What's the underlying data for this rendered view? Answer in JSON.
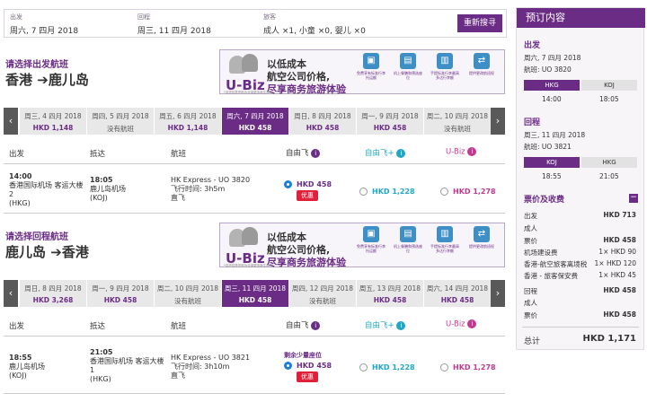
{
  "header": {
    "out_label": "出发",
    "out_value": "周六, 7 四月 2018",
    "ret_label": "回程",
    "ret_value": "周三, 11 四月 2018",
    "pax_label": "旅客",
    "pax_value": "成人 ×1, 小童 ×0, 婴儿 ×0",
    "search_button": "重新搜寻"
  },
  "banner": {
    "brand": "U-Biz",
    "line1": "以低成本",
    "line2": "航空公司价格,",
    "line3": "尽享商务旅游体验",
    "fine_print": "*该货包售完即为全部更多新生商务",
    "features": [
      "免费享有标准行李托运额",
      "机上餐膳和预选座位",
      "手提标准行李最高多达行李额",
      "提供更改航班权"
    ]
  },
  "outbound": {
    "title": "请选择出发航班",
    "from": "香港",
    "to": "鹿儿岛",
    "dates": [
      {
        "d": "周三, 4 四月 2018",
        "p": "HKD 1,148"
      },
      {
        "d": "周四, 5 四月 2018",
        "p": "没有航班"
      },
      {
        "d": "周五, 6 四月 2018",
        "p": "HKD 1,148"
      },
      {
        "d": "周六, 7 四月 2018",
        "p": "HKD 458"
      },
      {
        "d": "周日, 8 四月 2018",
        "p": "HKD 458"
      },
      {
        "d": "周一, 9 四月 2018",
        "p": "HKD 458"
      },
      {
        "d": "周二, 10 四月 2018",
        "p": "没有航班"
      }
    ],
    "cols": {
      "depart": "出发",
      "arrive": "抵达",
      "flight": "航班",
      "fare1": "自由飞",
      "fare2": "自由飞+",
      "fare3": "U-Biz"
    },
    "flight": {
      "dep_time": "14:00",
      "dep_place": "香港国际机场 客运大楼 2",
      "dep_code": "(HKG)",
      "arr_time": "18:05",
      "arr_place": "鹿儿岛机场",
      "arr_code": "(KOJ)",
      "no": "HK Express - UO 3820",
      "dur": "飞行时间: 3h5m",
      "type": "直飞",
      "p1": "HKD 458",
      "p2": "HKD 1,228",
      "p3": "HKD 1,278",
      "badge": "优惠"
    }
  },
  "inbound": {
    "title": "请选择回程航班",
    "from": "鹿儿岛",
    "to": "香港",
    "dates": [
      {
        "d": "周日, 8 四月 2018",
        "p": "HKD 3,268"
      },
      {
        "d": "周一, 9 四月 2018",
        "p": "HKD 458"
      },
      {
        "d": "周二, 10 四月 2018",
        "p": "没有航班"
      },
      {
        "d": "周三, 11 四月 2018",
        "p": "HKD 458"
      },
      {
        "d": "周四, 12 四月 2018",
        "p": "没有航班"
      },
      {
        "d": "周五, 13 四月 2018",
        "p": "HKD 458"
      },
      {
        "d": "周六, 14 四月 2018",
        "p": "HKD 458"
      }
    ],
    "cols": {
      "depart": "出发",
      "arrive": "抵达",
      "flight": "航班",
      "fare1": "自由飞",
      "fare2": "自由飞+",
      "fare3": "U-Biz"
    },
    "flight": {
      "dep_time": "18:55",
      "dep_place": "鹿儿岛机场",
      "dep_code": "(KOJ)",
      "arr_time": "21:05",
      "arr_place": "香港国际机场 客运大楼 1",
      "arr_code": "(HKG)",
      "no": "HK Express - UO 3821",
      "dur": "飞行时间: 3h10m",
      "type": "直飞",
      "seats_left": "剩余少量座位",
      "p1": "HKD 458",
      "p2": "HKD 1,228",
      "p3": "HKD 1,278",
      "badge": "优惠"
    }
  },
  "summary": {
    "title": "预订内容",
    "out_h": "出发",
    "out_date": "周六, 7 四月 2018",
    "out_flight": "航班: UO 3820",
    "out_from": "HKG",
    "out_to": "KOJ",
    "out_t1": "14:00",
    "out_t2": "18:05",
    "ret_h": "回程",
    "ret_date": "周三, 11 四月 2018",
    "ret_flight": "航班: UO 3821",
    "ret_from": "KOJ",
    "ret_to": "HKG",
    "ret_t1": "18:55",
    "ret_t2": "21:05",
    "fees_h": "票价及收费",
    "minus": "−",
    "rows": [
      [
        "出发",
        "HKD 713"
      ],
      [
        "成人",
        ""
      ],
      [
        "票价",
        "HKD 458"
      ],
      [
        "机场建设费",
        "1× HKD 90"
      ],
      [
        "香港-航空旅客离境税",
        "1× HKD 120"
      ],
      [
        "香港 - 旅客保安费",
        "1× HKD 45"
      ],
      [
        "回程",
        "HKD 458"
      ],
      [
        "成人",
        ""
      ],
      [
        "票价",
        "HKD 458"
      ]
    ],
    "total_label": "总计",
    "total_value": "HKD 1,171"
  },
  "colors": {
    "brand": "#6b2c86",
    "accent": "#1d7ed8",
    "badge": "#e0203a"
  }
}
